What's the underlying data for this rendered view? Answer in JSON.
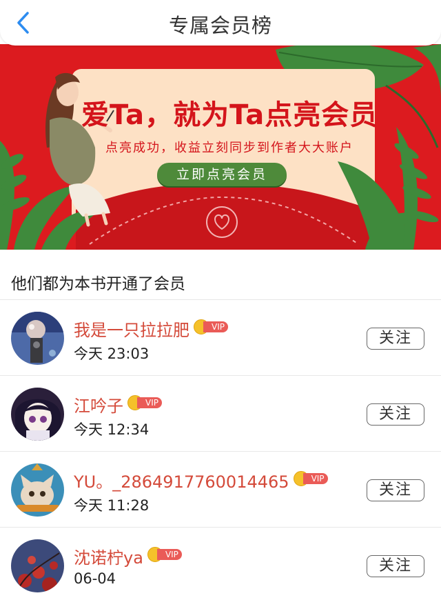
{
  "header": {
    "title": "专属会员榜",
    "back_icon": "chevron-left-icon"
  },
  "banner": {
    "headline": "爱Ta，就为Ta点亮会员",
    "subtitle": "点亮成功，收益立刻同步到作者大大账户",
    "cta_label": "立即点亮会员",
    "colors": {
      "background": "#dc1b1f",
      "card": "#fde1c5",
      "button": "#4e8a3a",
      "text": "#d4141b"
    }
  },
  "section": {
    "title": "他们都为本书开通了会员"
  },
  "members": [
    {
      "name": "我是一只拉拉肥",
      "time": "今天 23:03",
      "vip_label": "VIP",
      "follow_label": "关注"
    },
    {
      "name": "江吟子",
      "time": "今天 12:34",
      "vip_label": "VIP",
      "follow_label": "关注"
    },
    {
      "name": "YU。_2864917760014465",
      "time": "今天 11:28",
      "vip_label": "VIP",
      "follow_label": "关注"
    },
    {
      "name": "沈诺柠ya",
      "time": "06-04",
      "vip_label": "VIP",
      "follow_label": "关注"
    }
  ]
}
